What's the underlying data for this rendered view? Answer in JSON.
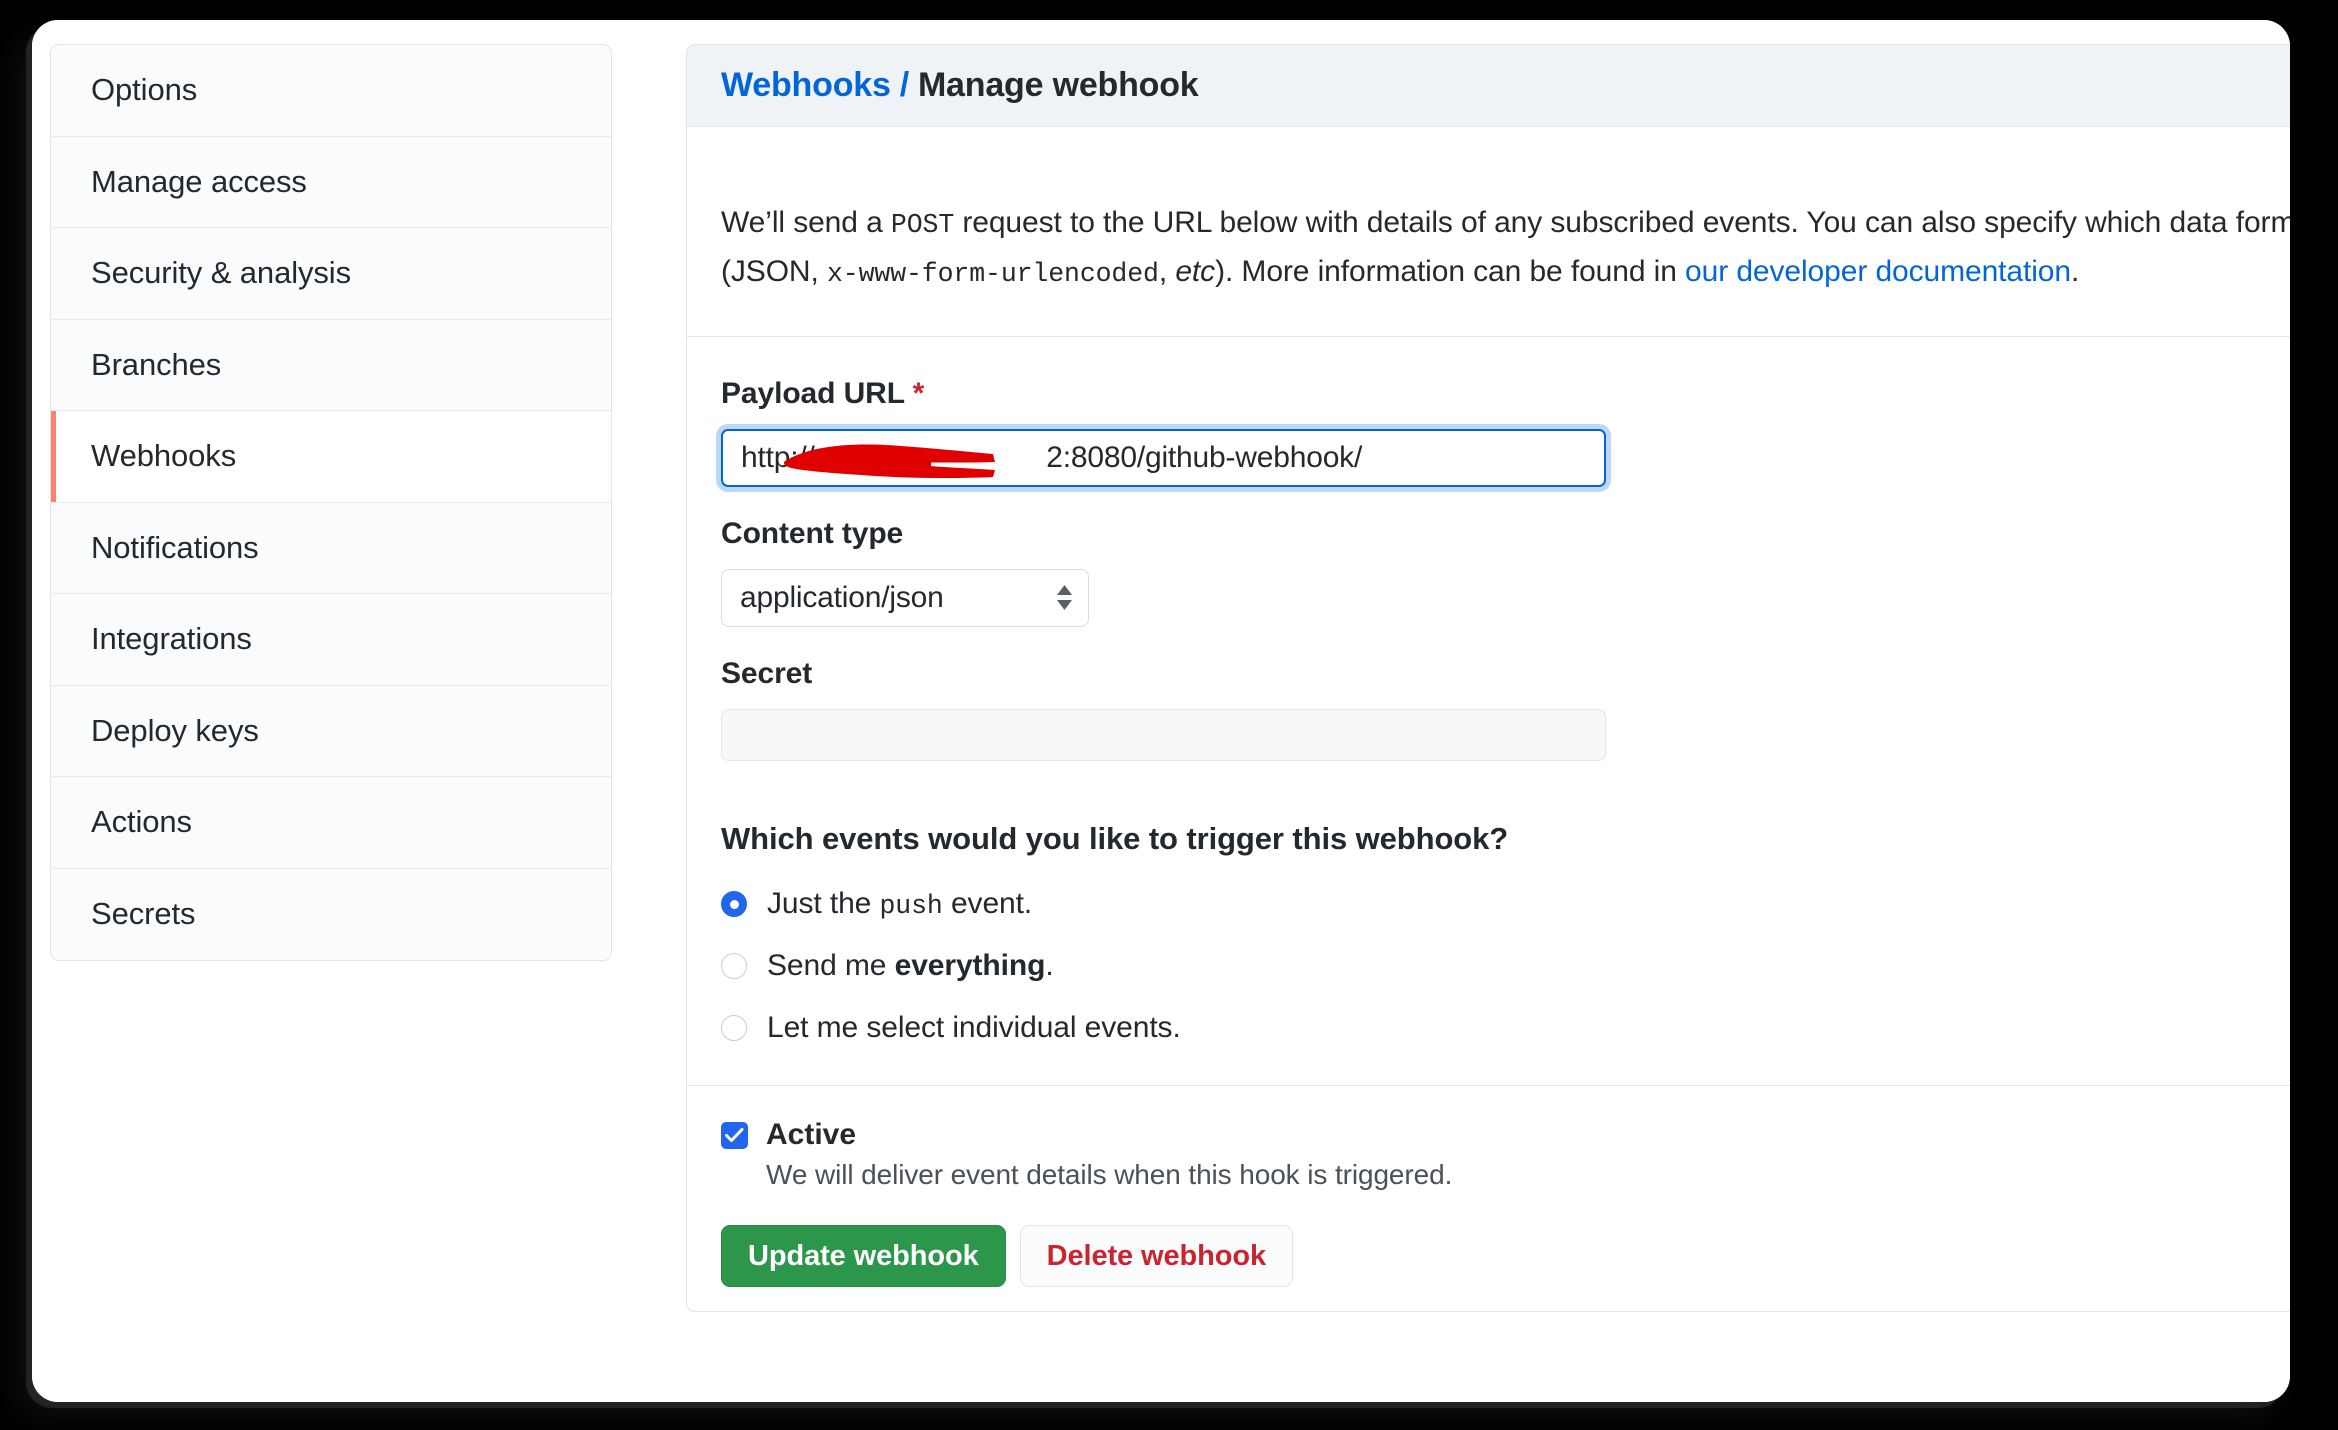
{
  "sidebar": {
    "items": [
      {
        "label": "Options",
        "selected": false
      },
      {
        "label": "Manage access",
        "selected": false
      },
      {
        "label": "Security & analysis",
        "selected": false
      },
      {
        "label": "Branches",
        "selected": false
      },
      {
        "label": "Webhooks",
        "selected": true
      },
      {
        "label": "Notifications",
        "selected": false
      },
      {
        "label": "Integrations",
        "selected": false
      },
      {
        "label": "Deploy keys",
        "selected": false
      },
      {
        "label": "Actions",
        "selected": false
      },
      {
        "label": "Secrets",
        "selected": false
      }
    ]
  },
  "panel": {
    "breadcrumb_link": "Webhooks",
    "breadcrumb_separator": "/",
    "breadcrumb_current": "Manage webhook",
    "intro": {
      "part1": "We’ll send a ",
      "code1": "POST",
      "part2": " request to the URL below with details of any subscribed events. You can also specify which data format you would like to receive (JSON, ",
      "code2": "x-www-form-urlencoded",
      "part3": ", ",
      "em1": "etc",
      "part4": "). More information can be found in ",
      "link": "our developer documentation",
      "part5": "."
    }
  },
  "form": {
    "payload_url": {
      "label": "Payload URL",
      "required_marker": "*",
      "value_prefix": "http://",
      "value_redacted": "███████████",
      "value_suffix": "2:8080/github-webhook/"
    },
    "content_type": {
      "label": "Content type",
      "value": "application/json"
    },
    "secret": {
      "label": "Secret",
      "value": ""
    },
    "events": {
      "question": "Which events would you like to trigger this webhook?",
      "options": [
        {
          "prefix": "Just the ",
          "code": "push",
          "suffix": " event.",
          "selected": true
        },
        {
          "prefix": "Send me ",
          "bold": "everything",
          "suffix": ".",
          "selected": false
        },
        {
          "prefix": "Let me select individual events.",
          "selected": false
        }
      ]
    },
    "active": {
      "label": "Active",
      "description": "We will deliver event details when this hook is triggered.",
      "checked": true
    },
    "buttons": {
      "update": "Update webhook",
      "delete": "Delete webhook"
    }
  },
  "colors": {
    "link": "#0366d6",
    "selected_nav_accent": "#f9826c",
    "primary_button": "#2c974b",
    "danger_text": "#cb2431",
    "radio_checked": "#2266ee",
    "redaction": "#e00000"
  }
}
